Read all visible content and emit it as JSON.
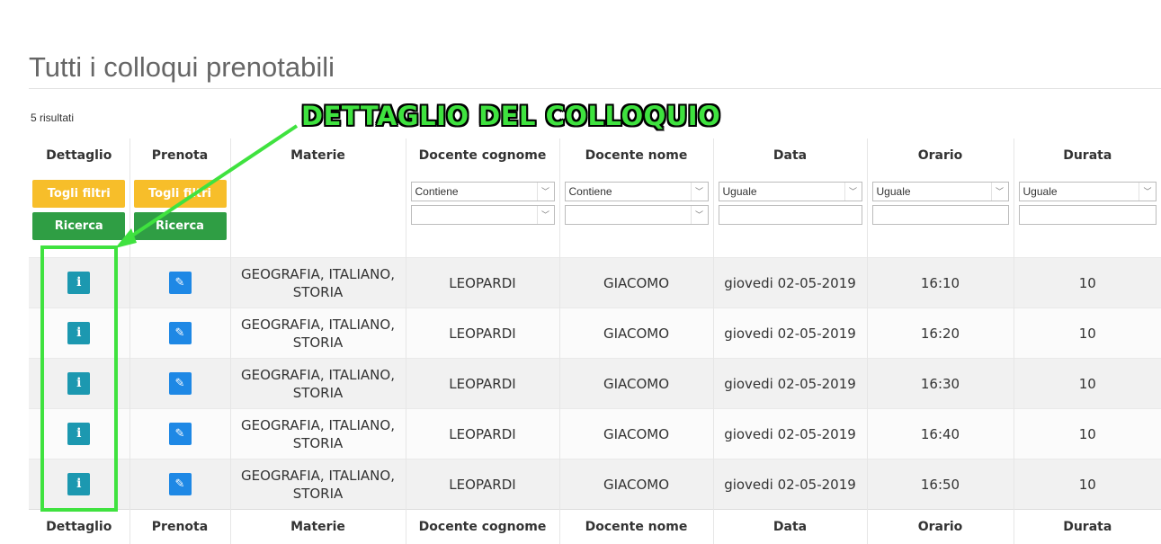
{
  "page": {
    "title": "Tutti i colloqui prenotabili",
    "result_count": "5 risultati"
  },
  "table": {
    "headers": [
      "Dettaglio",
      "Prenota",
      "Materie",
      "Docente cognome",
      "Docente nome",
      "Data",
      "Orario",
      "Durata"
    ],
    "filters": {
      "clear_label": "Togli filtri",
      "search_label": "Ricerca",
      "docente_cognome_op": "Contiene",
      "docente_nome_op": "Contiene",
      "data_op": "Uguale",
      "orario_op": "Uguale",
      "durata_op": "Uguale"
    },
    "rows": [
      {
        "materie": "GEOGRAFIA, ITALIANO, STORIA",
        "cognome": "LEOPARDI",
        "nome": "GIACOMO",
        "data": "giovedi 02-05-2019",
        "orario": "16:10",
        "durata": "10"
      },
      {
        "materie": "GEOGRAFIA, ITALIANO, STORIA",
        "cognome": "LEOPARDI",
        "nome": "GIACOMO",
        "data": "giovedi 02-05-2019",
        "orario": "16:20",
        "durata": "10"
      },
      {
        "materie": "GEOGRAFIA, ITALIANO, STORIA",
        "cognome": "LEOPARDI",
        "nome": "GIACOMO",
        "data": "giovedi 02-05-2019",
        "orario": "16:30",
        "durata": "10"
      },
      {
        "materie": "GEOGRAFIA, ITALIANO, STORIA",
        "cognome": "LEOPARDI",
        "nome": "GIACOMO",
        "data": "giovedi 02-05-2019",
        "orario": "16:40",
        "durata": "10"
      },
      {
        "materie": "GEOGRAFIA, ITALIANO, STORIA",
        "cognome": "LEOPARDI",
        "nome": "GIACOMO",
        "data": "giovedi 02-05-2019",
        "orario": "16:50",
        "durata": "10"
      }
    ],
    "info_glyph": "i",
    "edit_glyph": "✎"
  },
  "annotation": {
    "label": "DETTAGLIO DEL COLLOQUIO",
    "color": "#3fe23f"
  },
  "colors": {
    "info_button": "#1c98b0",
    "edit_button": "#1e88e5",
    "clear_button": "#f7be2a",
    "search_button": "#2f9e44"
  }
}
